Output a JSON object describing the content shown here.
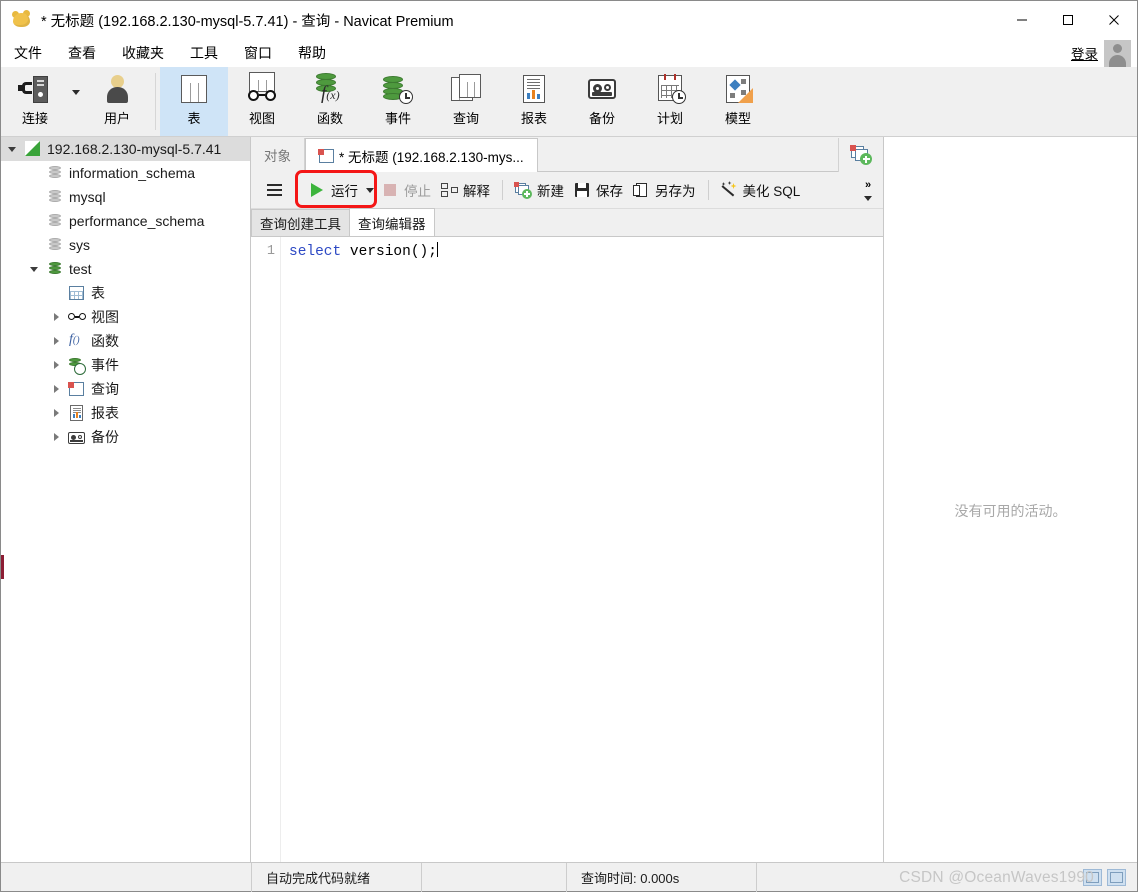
{
  "window": {
    "title": "* 无标题 (192.168.2.130-mysql-5.7.41) - 查询 - Navicat Premium",
    "app_icon": "navicat-logo-icon",
    "minimize": "minimize-icon",
    "maximize": "maximize-icon",
    "close": "close-icon"
  },
  "menubar": {
    "items": [
      {
        "label": "文件"
      },
      {
        "label": "查看"
      },
      {
        "label": "收藏夹"
      },
      {
        "label": "工具"
      },
      {
        "label": "窗口"
      },
      {
        "label": "帮助"
      }
    ],
    "login_label": "登录",
    "avatar": "user-avatar-icon"
  },
  "ribbon": {
    "left_group": [
      {
        "label": "连接",
        "icon": "connection-icon",
        "has_caret": true,
        "active": false
      },
      {
        "label": "用户",
        "icon": "user-icon",
        "has_caret": false,
        "active": false
      }
    ],
    "main_group": [
      {
        "label": "表",
        "icon": "table-icon",
        "active": true
      },
      {
        "label": "视图",
        "icon": "view-glasses-icon",
        "active": false
      },
      {
        "label": "函数",
        "icon": "function-fx-icon",
        "active": false
      },
      {
        "label": "事件",
        "icon": "event-clock-icon",
        "active": false
      },
      {
        "label": "查询",
        "icon": "query-icon",
        "active": false
      },
      {
        "label": "报表",
        "icon": "report-icon",
        "active": false
      },
      {
        "label": "备份",
        "icon": "backup-tape-icon",
        "active": false
      },
      {
        "label": "计划",
        "icon": "schedule-calendar-icon",
        "active": false
      },
      {
        "label": "模型",
        "icon": "model-diagram-icon",
        "active": false
      }
    ]
  },
  "sidebar": {
    "tree": [
      {
        "label": "192.168.2.130-mysql-5.7.41",
        "icon": "connection-node-icon",
        "indent": 0,
        "twisty": "expanded",
        "selected": true
      },
      {
        "label": "information_schema",
        "icon": "database-gray-icon",
        "indent": 1,
        "twisty": "none",
        "selected": false
      },
      {
        "label": "mysql",
        "icon": "database-gray-icon",
        "indent": 1,
        "twisty": "none",
        "selected": false
      },
      {
        "label": "performance_schema",
        "icon": "database-gray-icon",
        "indent": 1,
        "twisty": "none",
        "selected": false
      },
      {
        "label": "sys",
        "icon": "database-gray-icon",
        "indent": 1,
        "twisty": "none",
        "selected": false
      },
      {
        "label": "test",
        "icon": "database-green-icon",
        "indent": 1,
        "twisty": "expanded",
        "selected": false
      },
      {
        "label": "表",
        "icon": "table-node-icon",
        "indent": 2,
        "twisty": "none",
        "selected": false
      },
      {
        "label": "视图",
        "icon": "view-node-icon",
        "indent": 2,
        "twisty": "collapsed",
        "selected": false
      },
      {
        "label": "函数",
        "icon": "function-node-icon",
        "indent": 2,
        "twisty": "collapsed",
        "selected": false
      },
      {
        "label": "事件",
        "icon": "event-node-icon",
        "indent": 2,
        "twisty": "collapsed",
        "selected": false
      },
      {
        "label": "查询",
        "icon": "query-node-icon",
        "indent": 2,
        "twisty": "collapsed",
        "selected": false
      },
      {
        "label": "报表",
        "icon": "report-node-icon",
        "indent": 2,
        "twisty": "collapsed",
        "selected": false
      },
      {
        "label": "备份",
        "icon": "backup-node-icon",
        "indent": 2,
        "twisty": "collapsed",
        "selected": false
      }
    ]
  },
  "tabstrip": {
    "tabs": [
      {
        "label": "对象",
        "active": false,
        "icon": "none"
      },
      {
        "label": "* 无标题 (192.168.2.130-mys...",
        "active": true,
        "icon": "query-tab-icon"
      }
    ],
    "new_tab_icon": "new-query-tab-icon"
  },
  "query_toolbar": {
    "menu_icon": "hamburger-menu-icon",
    "buttons": [
      {
        "label": "运行",
        "icon": "run-play-icon",
        "disabled": false,
        "has_caret": true,
        "highlighted": true
      },
      {
        "label": "停止",
        "icon": "stop-square-icon",
        "disabled": true,
        "has_caret": false,
        "highlighted": false
      },
      {
        "label": "解释",
        "icon": "explain-icon",
        "disabled": false,
        "has_caret": false,
        "highlighted": false
      },
      {
        "label": "新建",
        "icon": "new-query-icon",
        "disabled": false,
        "has_caret": false,
        "highlighted": false
      },
      {
        "label": "保存",
        "icon": "save-floppy-icon",
        "disabled": false,
        "has_caret": false,
        "highlighted": false
      },
      {
        "label": "另存为",
        "icon": "save-as-icon",
        "disabled": false,
        "has_caret": false,
        "highlighted": false
      },
      {
        "label": "美化 SQL",
        "icon": "magic-wand-icon",
        "disabled": false,
        "has_caret": false,
        "highlighted": false
      }
    ],
    "overflow_icon": "chevron-double-right-icon",
    "overflow_caret": "chevron-down-icon",
    "highlight_color": "#f41616"
  },
  "subtabs": [
    {
      "label": "查询创建工具",
      "active": false
    },
    {
      "label": "查询编辑器",
      "active": true
    }
  ],
  "editor": {
    "lines": [
      {
        "number": "1",
        "keyword": "select",
        "rest": " version();"
      }
    ]
  },
  "right_panel": {
    "empty_message": "没有可用的活动。"
  },
  "statusbar": {
    "autocomplete_status": "自动完成代码就绪",
    "query_time": "查询时间: 0.000s",
    "icons": [
      "grid-view-icon",
      "form-view-icon"
    ]
  },
  "watermark": "CSDN @OceanWaves1990"
}
